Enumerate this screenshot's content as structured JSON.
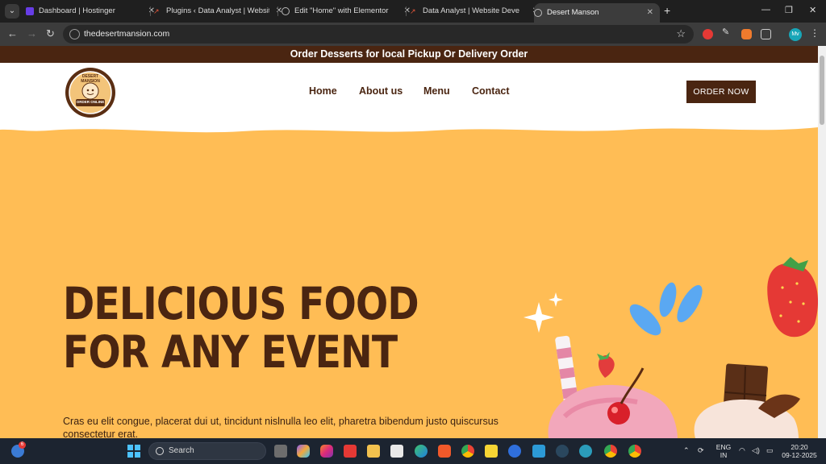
{
  "browser": {
    "tabs": [
      {
        "title": "Dashboard | Hostinger",
        "favicon_color": "#673de6"
      },
      {
        "title": "Plugins ‹ Data Analyst | Website",
        "favicon_color": "#e0553a"
      },
      {
        "title": "Edit \"Home\" with Elementor",
        "favicon_color": "#9a9a9a"
      },
      {
        "title": "Data Analyst | Website Develop",
        "favicon_color": "#e0553a"
      },
      {
        "title": "Desert Manson",
        "favicon_color": "#9a9a9a"
      }
    ],
    "active_tab_index": 4,
    "url": "thedesertmansion.com",
    "profile_initials": "Mv"
  },
  "site": {
    "promo_bar": "Order Desserts for local Pickup Or Delivery Order",
    "logo_text_top": "DESERT MANSION",
    "logo_text_bottom": "ORDER ONLINE",
    "nav": [
      {
        "label": "Home"
      },
      {
        "label": "About us"
      },
      {
        "label": "Menu"
      },
      {
        "label": "Contact"
      }
    ],
    "order_button": "ORDER NOW",
    "hero_title_line1": "Delicious food",
    "hero_title_line2": "for any event",
    "hero_text": "Cras eu elit congue, placerat dui ut, tincidunt nislnulla leo elit, pharetra bibendum justo quiscursus consectetur erat.",
    "colors": {
      "brand_brown": "#4a2511",
      "hero_bg": "#ffbd55",
      "white": "#ffffff"
    }
  },
  "taskbar": {
    "search_label": "Search",
    "weather_badge": "6",
    "language_line1": "ENG",
    "language_line2": "IN",
    "time": "20:20",
    "date": "09-12-2025"
  }
}
